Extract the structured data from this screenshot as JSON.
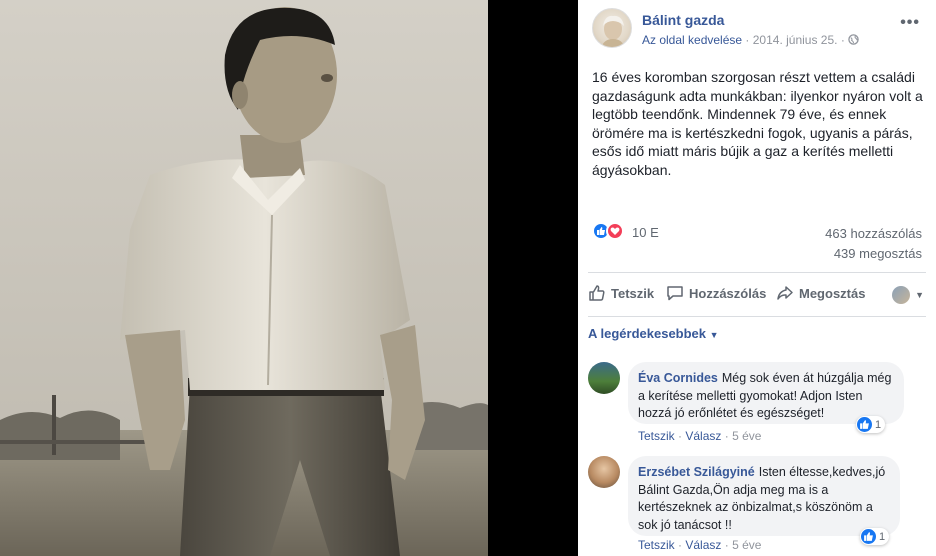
{
  "post": {
    "page_name": "Bálint gazda",
    "like_page": "Az oldal kedvelése",
    "dot": "·",
    "date": "2014. június 25.",
    "text": "16 éves koromban szorgosan részt vettem a családi gazdaságunk adta munkákban: ilyenkor nyáron volt a legtöbb teendőnk. Mindennek 79 éve, és ennek örömére ma is kertészkedni fogok, ugyanis a párás, esős idő miatt máris bújik a gaz a kerítés melletti ágyásokban.",
    "reaction_count": "10 E",
    "comments_count": "463 hozzászólás",
    "shares_count": "439 megosztás"
  },
  "actions": {
    "like": "Tetszik",
    "comment": "Hozzászólás",
    "share": "Megosztás"
  },
  "sort_label": "A legérdekesebbek",
  "comments": [
    {
      "author": "Éva Cornides",
      "text": "Még sok éven át húzgálja még a kerítése melletti gyomokat! Adjon Isten hozzá jó erőnlétet és egészséget!",
      "like": "Tetszik",
      "reply": "Válasz",
      "time": "5 éve",
      "reactions": "1"
    },
    {
      "author": "Erzsébet Szilágyiné",
      "text": "Isten éltesse,kedves,jó Bálint Gazda,Ön adja meg ma is a kertészeknek az önbizalmat,s köszönöm a sok jó tanácsot !!",
      "like": "Tetszik",
      "reply": "Válasz",
      "time": "5 éve",
      "reactions": "1"
    }
  ],
  "colors": {
    "link": "#385898",
    "secondary": "#606770",
    "meta": "#90949c",
    "like_blue": "#1877f2",
    "love_red": "#f33e58",
    "bubble": "#f2f3f5"
  }
}
